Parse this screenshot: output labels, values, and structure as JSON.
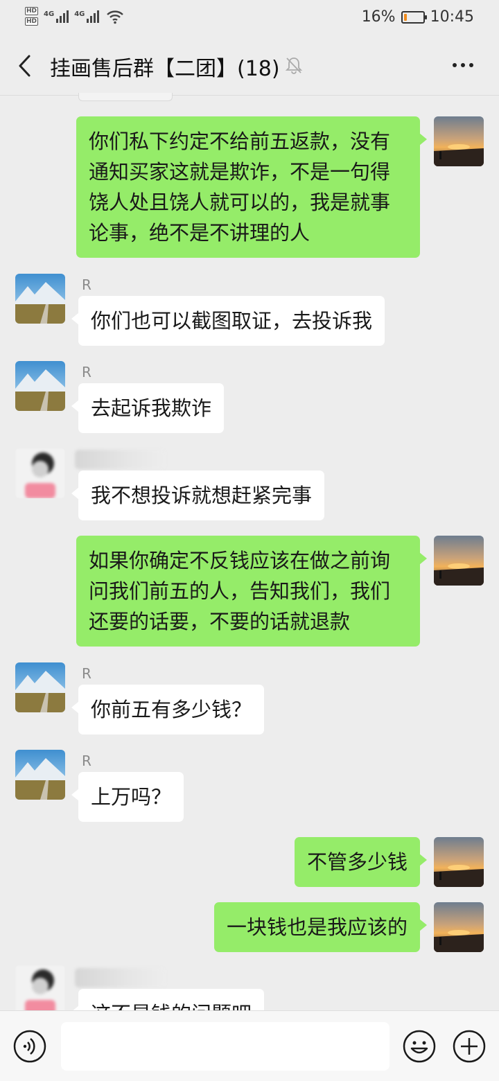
{
  "status_bar": {
    "hd_1": "HD",
    "hd_2": "HD",
    "net_1": "4G",
    "net_2": "4G",
    "battery_percent": "16%",
    "battery_level": 0.16,
    "battery_color": "#f08c1d",
    "time": "10:45"
  },
  "header": {
    "title": "挂画售后群【二团】(18)"
  },
  "messages": [
    {
      "side": "right",
      "text": "你们私下约定不给前五返款，没有\n通知买家这就是欺诈，不是一句得\n饶人处且饶人就可以的，我是就事\n论事，绝不是不讲理的人"
    },
    {
      "side": "left",
      "sender": "R",
      "text": "你们也可以截图取证，去投诉我"
    },
    {
      "side": "left",
      "sender": "R",
      "text": "去起诉我欺诈"
    },
    {
      "side": "left",
      "sender": "",
      "text": "我不想投诉就想赶紧完事"
    },
    {
      "side": "right",
      "text": "如果你确定不反钱应该在做之前询\n问我们前五的人，告知我们，我们\n还要的话要，不要的话就退款"
    },
    {
      "side": "left",
      "sender": "R",
      "text": "你前五有多少钱？"
    },
    {
      "side": "left",
      "sender": "R",
      "text": "上万吗？"
    },
    {
      "side": "right",
      "text": "不管多少钱"
    },
    {
      "side": "right",
      "text": "一块钱也是我应该的"
    },
    {
      "side": "left",
      "sender": "",
      "text": "这不是钱的问题吧"
    }
  ],
  "input": {
    "value": "",
    "placeholder": ""
  },
  "colors": {
    "mine_bubble": "#95ec69",
    "their_bubble": "#ffffff",
    "background": "#ededed"
  },
  "icons": {
    "back": "chevron-left-icon",
    "mute": "bell-off-icon",
    "more": "more-dots-icon",
    "voice": "voice-icon",
    "emoji": "emoji-icon",
    "plus": "plus-icon"
  }
}
